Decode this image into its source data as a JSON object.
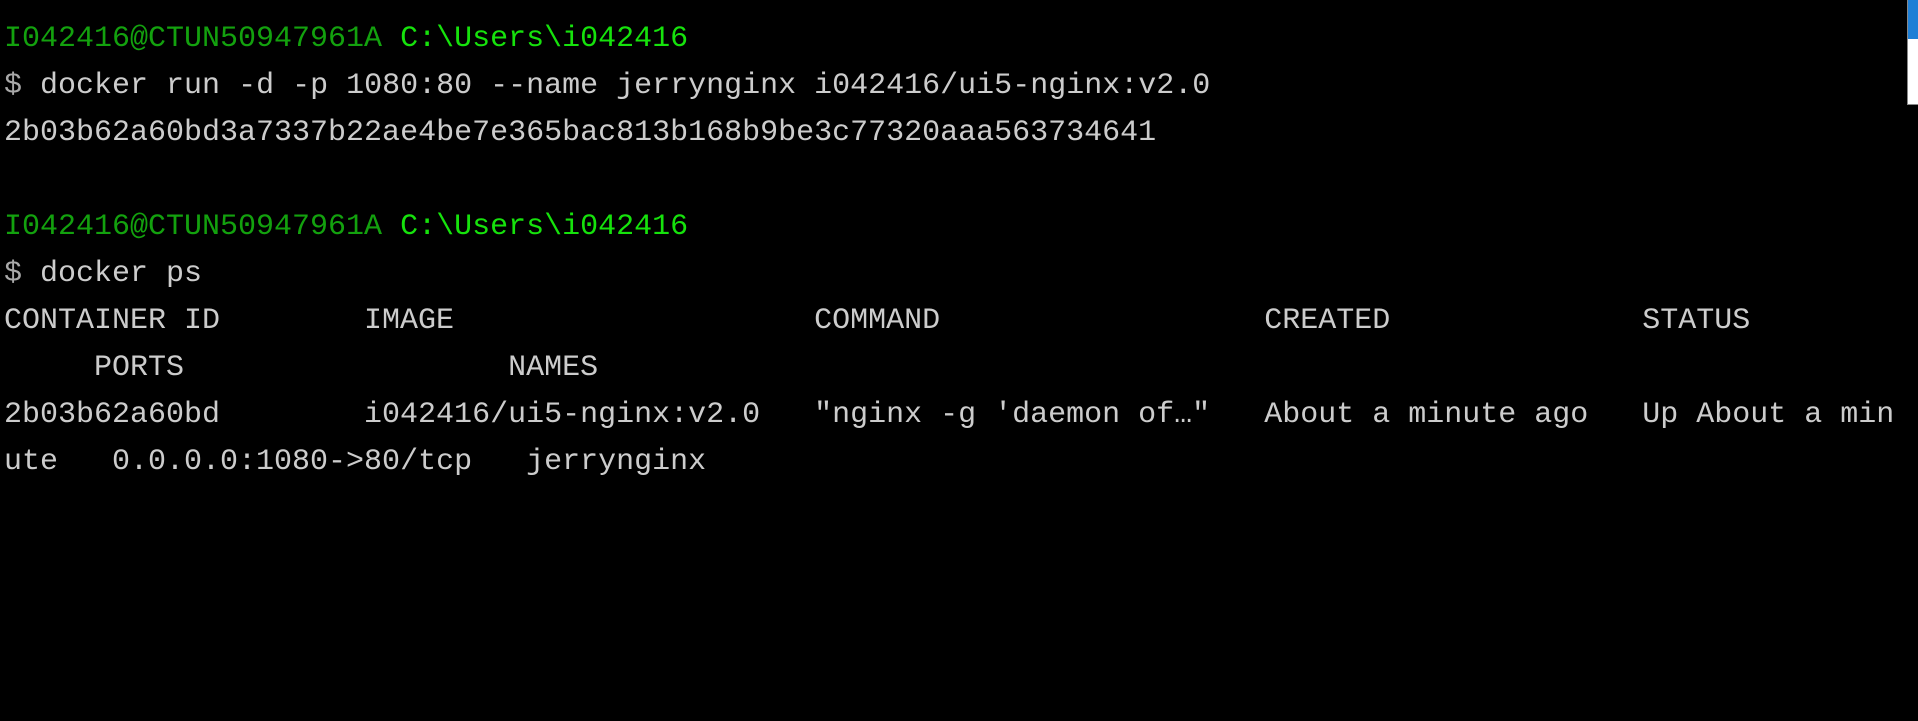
{
  "colors": {
    "background": "#000000",
    "text": "#cccccc",
    "user": "#13a10e",
    "path": "#16e20c",
    "scroll_thumb": "#1e7fd6"
  },
  "blocks": [
    {
      "prompt": {
        "user": "I042416@CTUN50947961A",
        "path": "C:\\Users\\i042416"
      },
      "symbol": "$",
      "command": "docker run -d -p 1080:80 --name jerrynginx i042416/ui5-nginx:v2.0",
      "output": "2b03b62a60bd3a7337b22ae4be7e365bac813b168b9be3c77320aaa563734641"
    },
    {
      "prompt": {
        "user": "I042416@CTUN50947961A",
        "path": "C:\\Users\\i042416"
      },
      "symbol": "$",
      "command": "docker ps"
    }
  ],
  "ps_table": {
    "headers": {
      "container_id": "CONTAINER ID",
      "image": "IMAGE",
      "command": "COMMAND",
      "created": "CREATED",
      "status": "STATUS",
      "ports": "PORTS",
      "names": "NAMES"
    },
    "rows": [
      {
        "container_id": "2b03b62a60bd",
        "image": "i042416/ui5-nginx:v2.0",
        "command": "\"nginx -g 'daemon of…\"",
        "created": "About a minute ago",
        "status_line1": "Up About a min",
        "status_line2": "ute",
        "ports": "0.0.0.0:1080->80/tcp",
        "names": "jerrynginx"
      }
    ]
  },
  "scrollbar": {
    "position": 0
  }
}
